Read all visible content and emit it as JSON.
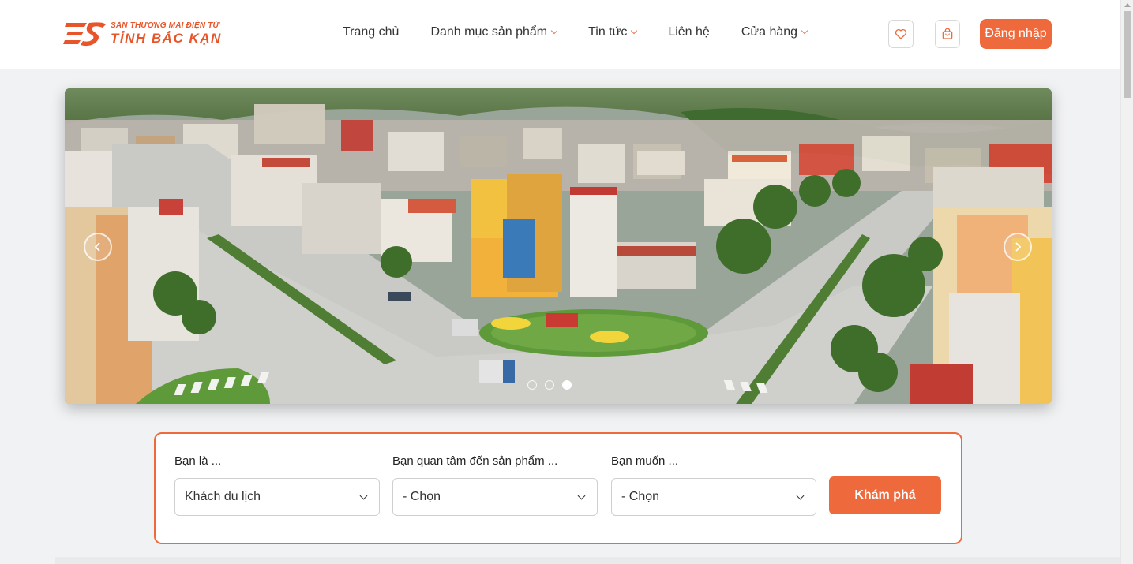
{
  "brand": {
    "tagline": "SÀN THƯƠNG MẠI ĐIỆN TỬ",
    "name": "TỈNH BẮC KẠN",
    "color": "#e8552a"
  },
  "nav": [
    {
      "label": "Trang chủ",
      "dropdown": false
    },
    {
      "label": "Danh mục sản phẩm",
      "dropdown": true
    },
    {
      "label": "Tin tức",
      "dropdown": true
    },
    {
      "label": "Liên hệ",
      "dropdown": false
    },
    {
      "label": "Cửa hàng",
      "dropdown": true
    }
  ],
  "header_actions": {
    "wishlist_icon": "heart-icon",
    "cart_icon": "shopping-bag-icon",
    "login_label": "Đăng nhập"
  },
  "carousel": {
    "slide_count": 3,
    "active_index": 2,
    "prev_icon": "chevron-left-icon",
    "next_icon": "chevron-right-icon"
  },
  "filter": {
    "who": {
      "label": "Bạn là ...",
      "value": "Khách du lịch"
    },
    "interest": {
      "label": "Bạn quan tâm đến sản phẩm ...",
      "value": "- Chọn"
    },
    "want": {
      "label": "Bạn muốn ...",
      "value": "- Chọn"
    },
    "submit_label": "Khám phá"
  },
  "colors": {
    "accent": "#ee6a3c",
    "header_bg": "#ffffff",
    "page_bg": "#f1f2f4"
  }
}
